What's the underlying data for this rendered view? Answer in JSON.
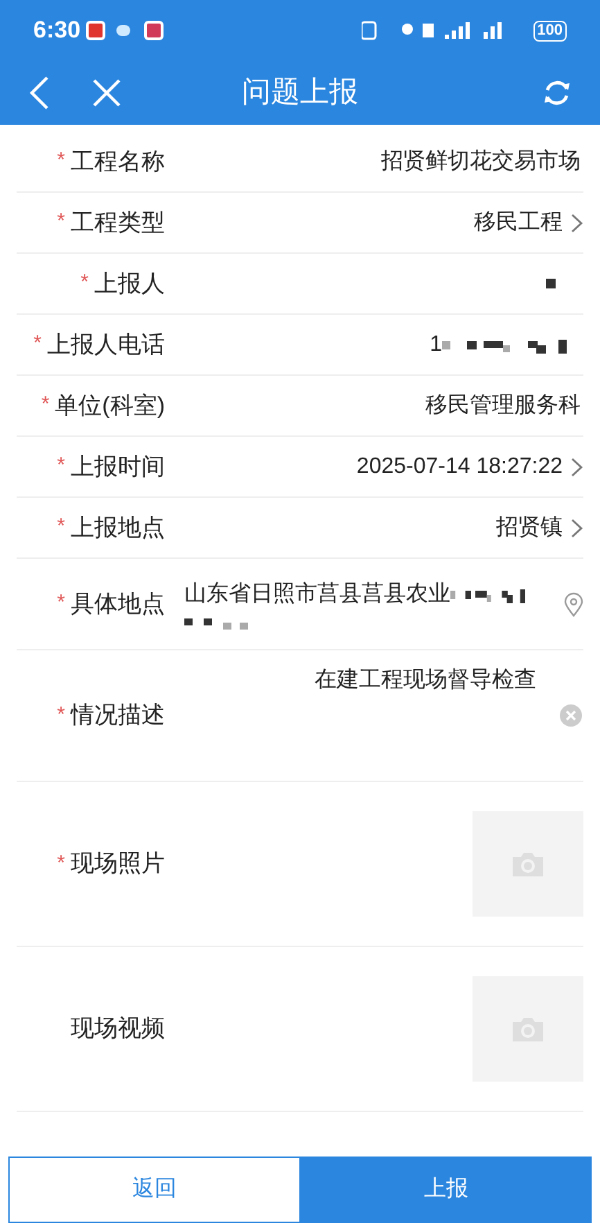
{
  "status_bar": {
    "time": "6:30",
    "battery": "100"
  },
  "header": {
    "title": "问题上报"
  },
  "fields": [
    {
      "kind": "text",
      "label": "工程名称",
      "required_mark": "*",
      "value": "招贤鲜切花交易市场"
    },
    {
      "kind": "select",
      "label": "工程类型",
      "required_mark": "*",
      "value": "移民工程"
    },
    {
      "kind": "text",
      "label": "上报人",
      "required_mark": "*",
      "redacted": true
    },
    {
      "kind": "text",
      "label": "上报人电话",
      "required_mark": "*",
      "value": "1",
      "redacted": true
    },
    {
      "kind": "text",
      "label": "单位(科室)",
      "required_mark": "*",
      "value": "移民管理服务科"
    },
    {
      "kind": "select",
      "label": "上报时间",
      "required_mark": "*",
      "value": "2025-07-14 18:27:22"
    },
    {
      "kind": "select",
      "label": "上报地点",
      "required_mark": "*",
      "value": "招贤镇"
    },
    {
      "kind": "location",
      "label": "具体地点",
      "required_mark": "*",
      "value": "山东省日照市莒县莒县农业",
      "redacted": true
    },
    {
      "kind": "textarea",
      "label": "情况描述",
      "required_mark": "*",
      "value": "在建工程现场督导检查"
    },
    {
      "kind": "photo",
      "label": "现场照片",
      "required_mark": "*"
    },
    {
      "kind": "photo",
      "label": "现场视频"
    }
  ],
  "buttons": [
    {
      "label": "返回",
      "primary": false
    },
    {
      "label": "上报",
      "primary": true
    }
  ]
}
